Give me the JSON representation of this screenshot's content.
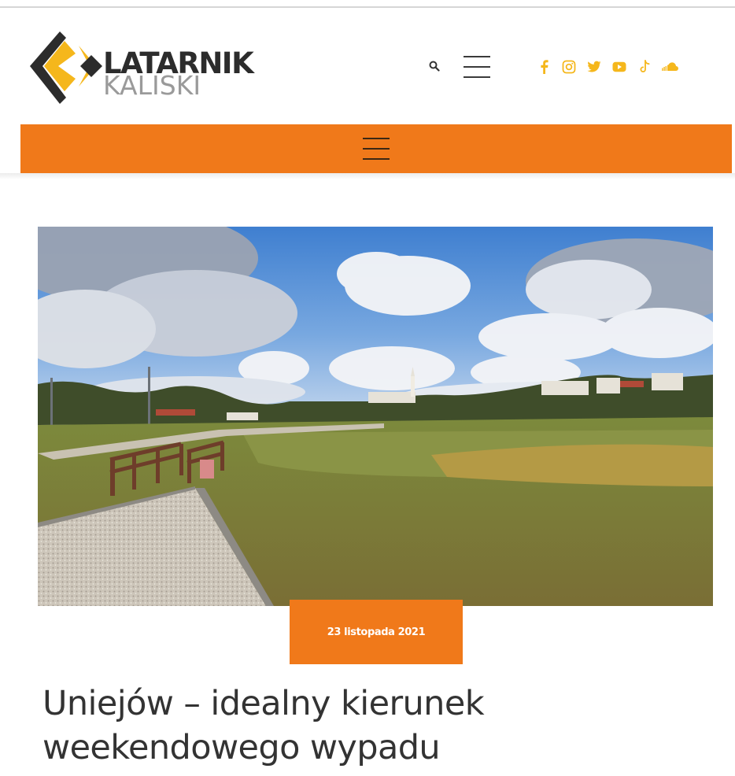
{
  "header": {
    "logo": {
      "line1": "LATARNIK",
      "line2": "KALISKI",
      "colors": {
        "yellow": "#f5b71c",
        "dark": "#2c2c2c",
        "grey": "#9a9a9a"
      }
    },
    "search_icon": "search-icon",
    "menu_icon": "hamburger-menu-icon"
  },
  "social": {
    "color": "#f5b71c",
    "items": [
      {
        "name": "facebook",
        "icon": "facebook-icon"
      },
      {
        "name": "instagram",
        "icon": "instagram-icon"
      },
      {
        "name": "twitter",
        "icon": "twitter-icon"
      },
      {
        "name": "youtube",
        "icon": "youtube-icon"
      },
      {
        "name": "tiktok",
        "icon": "tiktok-icon"
      },
      {
        "name": "soundcloud",
        "icon": "soundcloud-icon"
      }
    ]
  },
  "navbar": {
    "color": "#f0791a",
    "menu_icon": "hamburger-menu-icon"
  },
  "article": {
    "image": "lakeside-park-photo",
    "date": "23 listopada 2021",
    "title": "Uniejów – idealny kierunek weekendowego wypadu"
  }
}
